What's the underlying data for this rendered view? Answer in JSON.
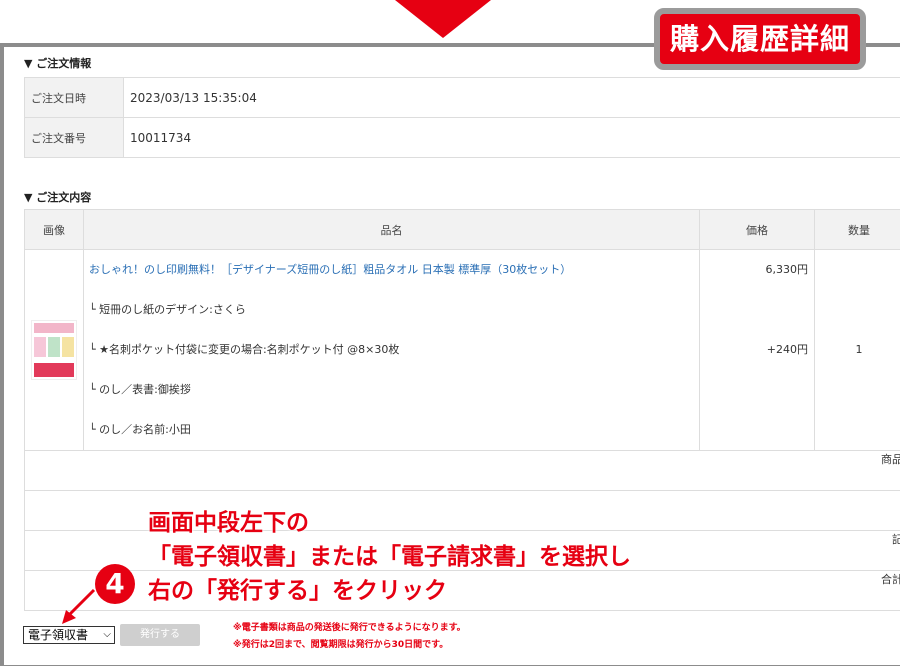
{
  "badge": "購入履歴詳細",
  "order_info": {
    "title": "▼ ご注文情報",
    "rows": [
      {
        "label": "ご注文日時",
        "value": "2023/03/13 15:35:04"
      },
      {
        "label": "ご注文番号",
        "value": "10011734"
      }
    ]
  },
  "order_items": {
    "title": "▼ ご注文内容",
    "headers": {
      "image": "画像",
      "name": "品名",
      "price": "価格",
      "qty": "数量"
    },
    "item": {
      "title": "おしゃれ！のし印刷無料！［デザイナーズ短冊のし紙］粗品タオル 日本製 標準厚（30枚セット）",
      "options": [
        "└ 短冊のし紙のデザイン:さくら",
        "└ ★名刺ポケット付袋に変更の場合:名刺ポケット付 @8×30枚",
        "└ のし／表書:御挨拶",
        "└ のし／お名前:小田"
      ],
      "price": "6,330円",
      "option_price": "+240円",
      "qty": "1"
    },
    "summary": [
      "商品",
      "",
      "記",
      "合計"
    ]
  },
  "annotation": {
    "step": "4",
    "lines": [
      "画面中段左下の",
      "「電子領収書」または「電子請求書」を選択し",
      "右の「発行する」をクリック"
    ]
  },
  "controls": {
    "select_value": "電子領収書",
    "issue_button": "発行する"
  },
  "notes": [
    "※電子書類は商品の発送後に発行できるようになります。",
    "※発行は2回まで、閲覧期限は発行から30日間です。"
  ]
}
